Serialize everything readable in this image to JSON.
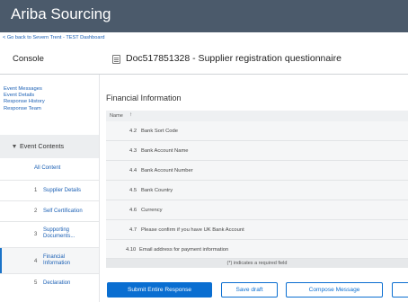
{
  "app": {
    "title": "Ariba Sourcing"
  },
  "back_link": "< Go back to Severn Trent - TEST Dashboard",
  "console_label": "Console",
  "document": {
    "title": "Doc517851328 - Supplier registration questionnaire",
    "icon": "document-icon"
  },
  "nav_links": [
    "Event Messages",
    "Event Details",
    "Response History",
    "Response Team"
  ],
  "event_contents": {
    "label": "Event Contents"
  },
  "left_items": [
    {
      "number": "",
      "label_lines": [
        "All Content"
      ]
    },
    {
      "number": "1",
      "label_lines": [
        "Supplier Details"
      ]
    },
    {
      "number": "2",
      "label_lines": [
        "Self Certification"
      ]
    },
    {
      "number": "3",
      "label_lines": [
        "Supporting",
        "Documents..."
      ]
    },
    {
      "number": "4",
      "label_lines": [
        "Financial",
        "Information"
      ]
    },
    {
      "number": "5",
      "label_lines": [
        "Declaration"
      ]
    }
  ],
  "section": {
    "heading": "Financial Information",
    "column_header": "Name",
    "sort_icon": "sort-up-arrow-icon"
  },
  "questions": [
    {
      "number": "4.2",
      "text": "Bank Sort Code"
    },
    {
      "number": "4.3",
      "text": "Bank Account Name"
    },
    {
      "number": "4.4",
      "text": "Bank Account Number"
    },
    {
      "number": "4.5",
      "text": "Bank Country"
    },
    {
      "number": "4.6",
      "text": "Currency"
    },
    {
      "number": "4.7",
      "text": "Please confirm if you have UK Bank Account"
    },
    {
      "number": "4.10",
      "text": "Email address for payment information"
    }
  ],
  "required_note": "(*) indicates a required field",
  "buttons": {
    "submit": "Submit Entire Response",
    "save_draft": "Save draft",
    "compose": "Compose Message"
  },
  "colors": {
    "header_bg": "#4b5a6b",
    "primary": "#0a6ed1",
    "link": "#1a5fb4"
  }
}
